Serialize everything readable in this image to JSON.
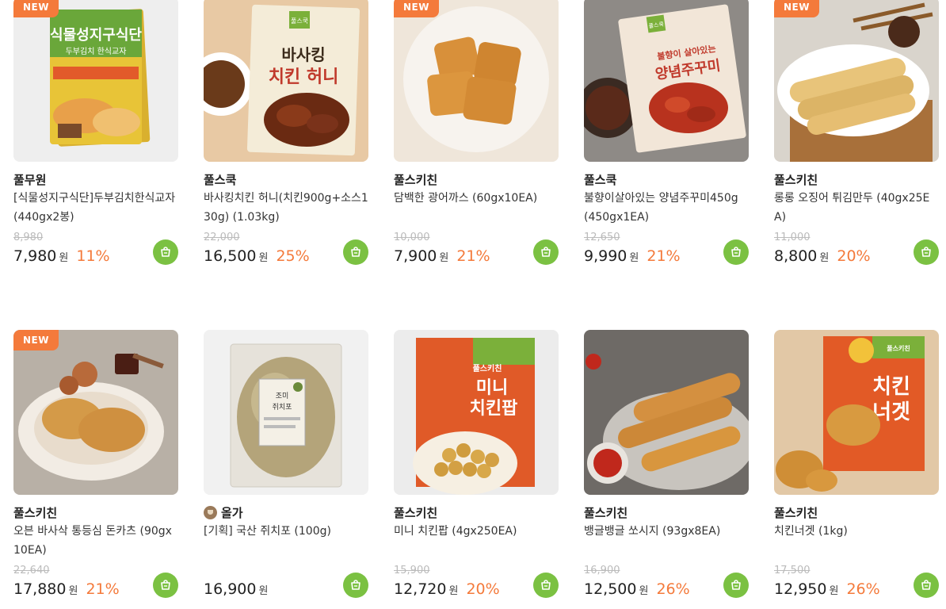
{
  "currency_unit": "원",
  "colors": {
    "accent_orange": "#f47a3b",
    "cart_green": "#7bc142",
    "new_badge": "#f47a3b"
  },
  "products": [
    {
      "badge": "NEW",
      "brand": "풀무원",
      "name": "[식물성지구식단]두부김치한식교자 (440gx2봉)",
      "orig_price": "8,980",
      "price": "7,980",
      "discount": "11%",
      "icon": "cart-icon"
    },
    {
      "badge": "",
      "brand": "풀스쿡",
      "name": "바사킹치킨 허니(치킨900g+소스130g) (1.03kg)",
      "orig_price": "22,000",
      "price": "16,500",
      "discount": "25%",
      "icon": "cart-icon"
    },
    {
      "badge": "NEW",
      "brand": "풀스키친",
      "name": "담백한 광어까스 (60gx10EA)",
      "orig_price": "10,000",
      "price": "7,900",
      "discount": "21%",
      "icon": "cart-icon"
    },
    {
      "badge": "",
      "brand": "풀스쿡",
      "name": "불향이살아있는 양념주꾸미450g (450gx1EA)",
      "orig_price": "12,650",
      "price": "9,990",
      "discount": "21%",
      "icon": "cart-icon"
    },
    {
      "badge": "NEW",
      "brand": "풀스키친",
      "name": "롱롱 오징어 튀김만두 (40gx25EA)",
      "orig_price": "11,000",
      "price": "8,800",
      "discount": "20%",
      "icon": "cart-icon"
    },
    {
      "badge": "NEW",
      "brand": "풀스키친",
      "name": "오븐 바사삭 통등심 돈카츠 (90gx10EA)",
      "orig_price": "22,640",
      "price": "17,880",
      "discount": "21%",
      "icon": "cart-icon"
    },
    {
      "badge": "",
      "brand": "올가",
      "brand_has_icon": true,
      "name": "[기획] 국산 쥐치포 (100g)",
      "orig_price": "",
      "price": "16,900",
      "discount": "",
      "icon": "cart-icon"
    },
    {
      "badge": "",
      "brand": "풀스키친",
      "name": "미니 치킨팝 (4gx250EA)",
      "orig_price": "15,900",
      "price": "12,720",
      "discount": "20%",
      "icon": "cart-icon"
    },
    {
      "badge": "",
      "brand": "풀스키친",
      "name": "뱅글뱅글 쏘시지 (93gx8EA)",
      "orig_price": "16,900",
      "price": "12,500",
      "discount": "26%",
      "icon": "cart-icon"
    },
    {
      "badge": "",
      "brand": "풀스키친",
      "name": "치킨너겟 (1kg)",
      "orig_price": "17,500",
      "price": "12,950",
      "discount": "26%",
      "icon": "cart-icon"
    }
  ],
  "package_text": {
    "p0_line1": "식물성지구식단",
    "p0_line2": "두부김치 한식교자",
    "p1_brand": "풀스쿡",
    "p1_line1": "바사킹",
    "p1_line2": "치킨 허니",
    "p3_brand": "풀스쿡",
    "p3_line1": "불향이 살아있는",
    "p3_line2": "양념주꾸미",
    "p6_line1": "조미",
    "p6_line2": "쥐치포",
    "p7_brand": "풀스키친",
    "p7_line1": "미니",
    "p7_line2": "치킨팝",
    "p9_brand": "풀스키친",
    "p9_line1": "치킨",
    "p9_line2": "너겟"
  }
}
